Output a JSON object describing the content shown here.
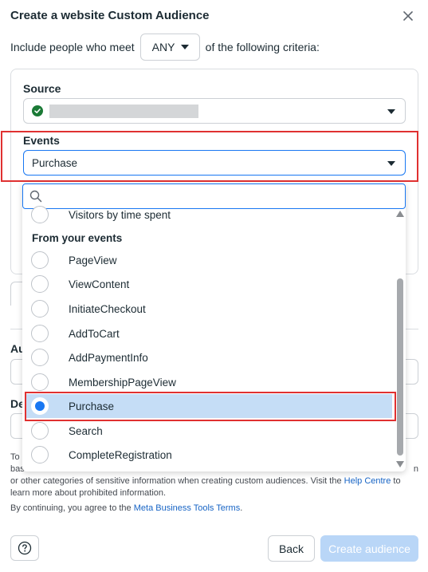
{
  "dialog": {
    "title": "Create a website Custom Audience",
    "close_icon": "close-icon"
  },
  "criteria": {
    "prefix": "Include people who meet",
    "match_value": "ANY",
    "suffix": "of the following criteria:"
  },
  "source": {
    "label": "Source",
    "status_icon": "check-circle-icon",
    "status_color": "#1b7a36"
  },
  "events": {
    "label": "Events",
    "selected_value": "Purchase"
  },
  "dropdown": {
    "search_placeholder": "",
    "partial_item": "Visitors by time spent",
    "group_heading": "From your events",
    "options": [
      {
        "label": "PageView",
        "selected": false
      },
      {
        "label": "ViewContent",
        "selected": false
      },
      {
        "label": "InitiateCheckout",
        "selected": false
      },
      {
        "label": "AddToCart",
        "selected": false
      },
      {
        "label": "AddPaymentInfo",
        "selected": false
      },
      {
        "label": "MembershipPageView",
        "selected": false
      },
      {
        "label": "Purchase",
        "selected": true
      },
      {
        "label": "Search",
        "selected": false
      },
      {
        "label": "CompleteRegistration",
        "selected": false
      }
    ]
  },
  "background_fields": {
    "audience_label_fragment": "Au",
    "description_label_fragment": "De"
  },
  "notice": {
    "line1_prefix": "To c",
    "line2_prefix": "bas",
    "line2_suffix": "n",
    "line3": "or other categories of sensitive information when creating custom audiences. Visit the",
    "help_centre_link": "Help Centre",
    "line3_end": "to",
    "line4": "learn more about prohibited information."
  },
  "terms": {
    "prefix": "By continuing, you agree to the",
    "link": "Meta Business Tools Terms",
    "suffix": "."
  },
  "footer": {
    "help_icon": "help-circle-icon",
    "back_label": "Back",
    "create_label": "Create audience"
  },
  "colors": {
    "accent": "#1877f2",
    "selected_bg": "#c5ddf6",
    "highlight_outline": "#e03131",
    "disabled_button": "#b9d6f7",
    "link": "#1764c5"
  }
}
